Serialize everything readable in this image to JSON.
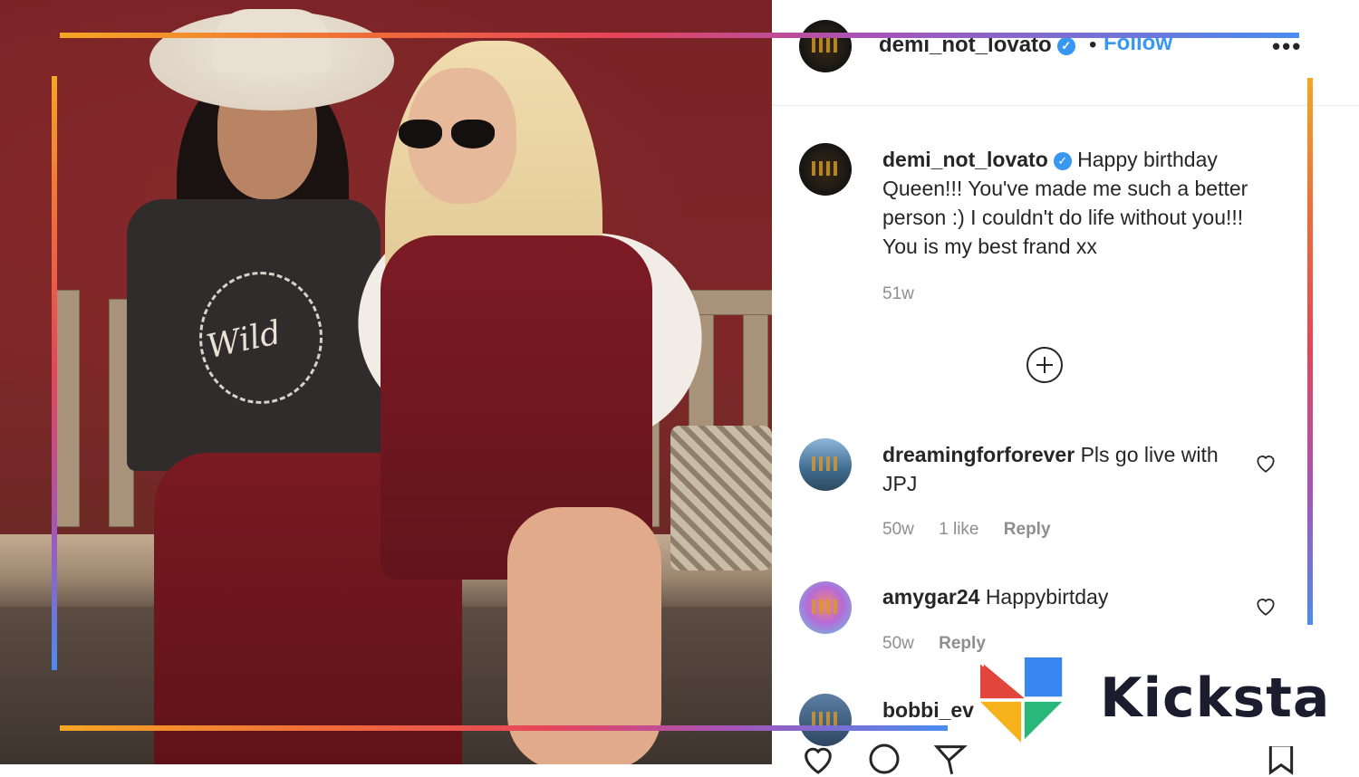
{
  "post": {
    "header": {
      "username": "demi_not_lovato",
      "separator": "•",
      "follow_label": "Follow",
      "more_label": "•••"
    },
    "caption": {
      "username": "demi_not_lovato",
      "text": "Happy birthday Queen!!! You've made me such a better person :) I couldn't do life without you!!! You is my best frand xx",
      "age": "51w"
    },
    "comments": [
      {
        "username": "dreamingforforever",
        "text": "Pls go live with JPJ",
        "age": "50w",
        "likes": "1 like",
        "reply": "Reply"
      },
      {
        "username": "amygar24",
        "text": "Happybirtday",
        "age": "50w",
        "reply": "Reply"
      },
      {
        "username": "bobbi_ev"
      }
    ]
  },
  "photo": {
    "shirt_text": "Wild"
  },
  "brand": {
    "name": "Kicksta"
  },
  "colors": {
    "link_blue": "#3897f0",
    "frame_gradient": [
      "#f5a623",
      "#ef6b3a",
      "#e6445a",
      "#a853b8",
      "#4a8cf0"
    ],
    "brand_logo": [
      "#e2453c",
      "#f5b21a",
      "#2ab87a",
      "#3a86f0"
    ]
  },
  "icons": [
    "verified-icon",
    "more-icon",
    "add-comment-icon",
    "heart-icon",
    "comment-icon",
    "share-icon",
    "save-icon"
  ]
}
